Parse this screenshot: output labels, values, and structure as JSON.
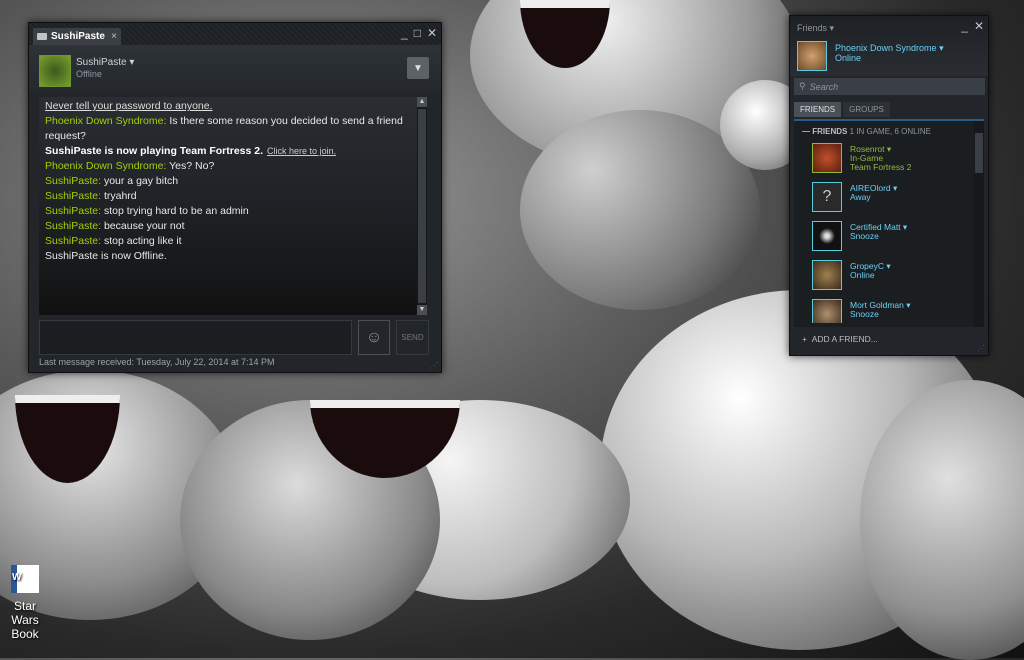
{
  "chat": {
    "tab_title": "SushiPaste",
    "user_name": "SushiPaste",
    "user_status": "Offline",
    "messages": [
      {
        "text": "Never tell your password to anyone."
      },
      {
        "sender": "Phoenix Down Syndrome:",
        "text": " Is there some reason you decided to send a friend request?"
      },
      {
        "text": "SushiPaste is now playing Team Fortress 2.",
        "link": "Click here to join."
      },
      {
        "sender": "Phoenix Down Syndrome:",
        "text": " Yes? No?"
      },
      {
        "sender": "SushiPaste:",
        "text": " your a gay bitch"
      },
      {
        "sender": "SushiPaste:",
        "text": " tryahrd"
      },
      {
        "sender": "SushiPaste:",
        "text": " stop trying hard to be an admin"
      },
      {
        "sender": "SushiPaste:",
        "text": " because your not"
      },
      {
        "sender": "SushiPaste:",
        "text": " stop acting like it"
      },
      {
        "text": "SushiPaste is now Offline."
      }
    ],
    "send_label": "SEND",
    "last_message": "Last message received: Tuesday, July 22, 2014 at 7:14 PM"
  },
  "friends": {
    "title": "Friends",
    "self_name": "Phoenix Down Syndrome",
    "self_status": "Online",
    "search_placeholder": "Search",
    "tabs": [
      "FRIENDS",
      "GROUPS"
    ],
    "group_label": "FRIENDS",
    "group_sub": "1 IN GAME, 6 ONLINE",
    "list": [
      {
        "name": "Rosenrot",
        "status": "In-Game",
        "game": "Team Fortress 2"
      },
      {
        "name": "AIREOlord",
        "status": "Away",
        "game": ""
      },
      {
        "name": "Certified Matt",
        "status": "Snooze",
        "game": ""
      },
      {
        "name": "GropeyC",
        "status": "Online",
        "game": ""
      },
      {
        "name": "Mort Goldman",
        "status": "Snooze",
        "game": ""
      }
    ],
    "add_friend": "ADD A FRIEND..."
  },
  "desktop": {
    "icon_label": "Star Wars Book",
    "icon_name": "word-document-icon"
  },
  "colors": {
    "friend_name_green": "#a3cf06",
    "online_blue": "#6dcff6",
    "ingame_green": "#90ba3c"
  }
}
